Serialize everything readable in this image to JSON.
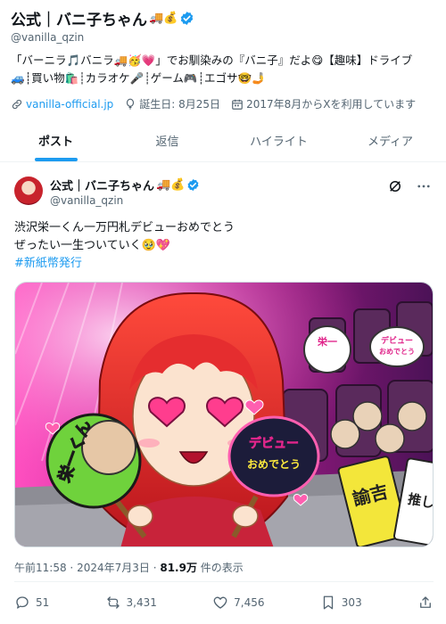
{
  "profile": {
    "name": "公式｜バニ子ちゃん",
    "name_emoji": "🚚💰",
    "handle": "@vanilla_qzin",
    "bio_line1": "「バーニラ🎵バニラ🚚🥳💗」でお馴染みの『バニ子』だよ😋【趣味】ドライブ",
    "bio_line2": "🚙┊買い物🛍️┊カラオケ🎤┊ゲーム🎮┊エゴサ🤓🤳",
    "website": "vanilla-official.jp",
    "birthday": "誕生日: 8月25日",
    "joined": "2017年8月からXを利用しています"
  },
  "tabs": [
    "ポスト",
    "返信",
    "ハイライト",
    "メディア"
  ],
  "tweet": {
    "name": "公式｜バニ子ちゃん",
    "name_emoji": "🚚💰",
    "handle": "@vanilla_qzin",
    "text_line1": "渋沢栄一くん一万円札デビューおめでとう",
    "text_line2": "ぜったい一生ついていく🥹💖",
    "hashtag": "#新紙幣発行",
    "media_texts": {
      "fan_left": "栄一くん",
      "fan_right_line1": "デビュー",
      "fan_right_line2": "おめでとう",
      "bg_fan_1": "栄一",
      "bg_fan_2": "デビュー",
      "bg_fan_3": "おめでとう",
      "board_1": "諭吉",
      "board_2": "推し"
    },
    "time": "午前11:58",
    "date": "2024年7月3日",
    "views_count": "81.9万",
    "views_label": "件の表示",
    "stats": {
      "replies": "51",
      "reposts": "3,431",
      "likes": "7,456",
      "bookmarks": "303"
    }
  },
  "colors": {
    "accent": "#1d9bf0",
    "verified": "#1d9bf0",
    "muted": "#536471",
    "hair": "#d8262b"
  }
}
